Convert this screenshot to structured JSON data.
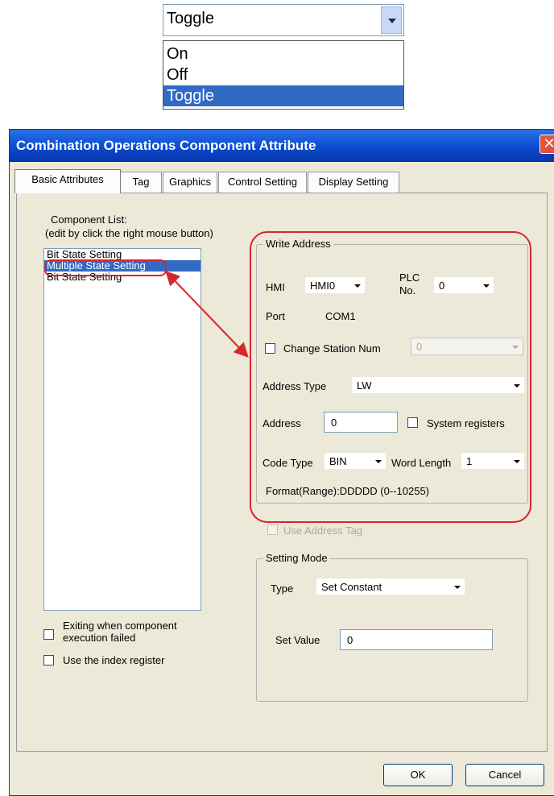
{
  "dropdown": {
    "value": "Toggle",
    "options": [
      "On",
      "Off",
      "Toggle"
    ]
  },
  "dialog": {
    "title": "Combination Operations Component Attribute",
    "close": "✕",
    "tabs": [
      "Basic Attributes",
      "Tag",
      "Graphics",
      "Control Setting",
      "Display Setting"
    ],
    "component_list": {
      "label1": "Component List:",
      "label2": "(edit by click the right mouse button)",
      "items": [
        "Bit State Setting",
        "Multiple State Setting",
        "Bit State Setting"
      ]
    },
    "exiting_label1": "Exiting when component",
    "exiting_label2": "execution failed",
    "index_register": "Use the index register",
    "write_address": {
      "legend": "Write Address",
      "hmi_label": "HMI",
      "hmi_value": "HMI0",
      "plc_label1": "PLC",
      "plc_label2": "No.",
      "plc_value": "0",
      "port_label": "Port",
      "port_value": "COM1",
      "change_station": "Change Station Num",
      "station_value": "0",
      "addr_type_label": "Address Type",
      "addr_type_value": "LW",
      "address_label": "Address",
      "address_value": "0",
      "system_registers": "System registers",
      "code_type_label": "Code Type",
      "code_type_value": "BIN",
      "word_length_label": "Word Length",
      "word_length_value": "1",
      "format": "Format(Range):DDDDD (0--10255)",
      "use_address_tag": "Use Address Tag"
    },
    "setting_mode": {
      "legend": "Setting Mode",
      "type_label": "Type",
      "type_value": "Set Constant",
      "set_value_label": "Set Value",
      "set_value": "0"
    },
    "buttons": {
      "ok": "OK",
      "cancel": "Cancel"
    }
  },
  "colors": {
    "title_bar": "#0a4ad0",
    "selection": "#316ac5",
    "annotation": "#d8262a"
  }
}
